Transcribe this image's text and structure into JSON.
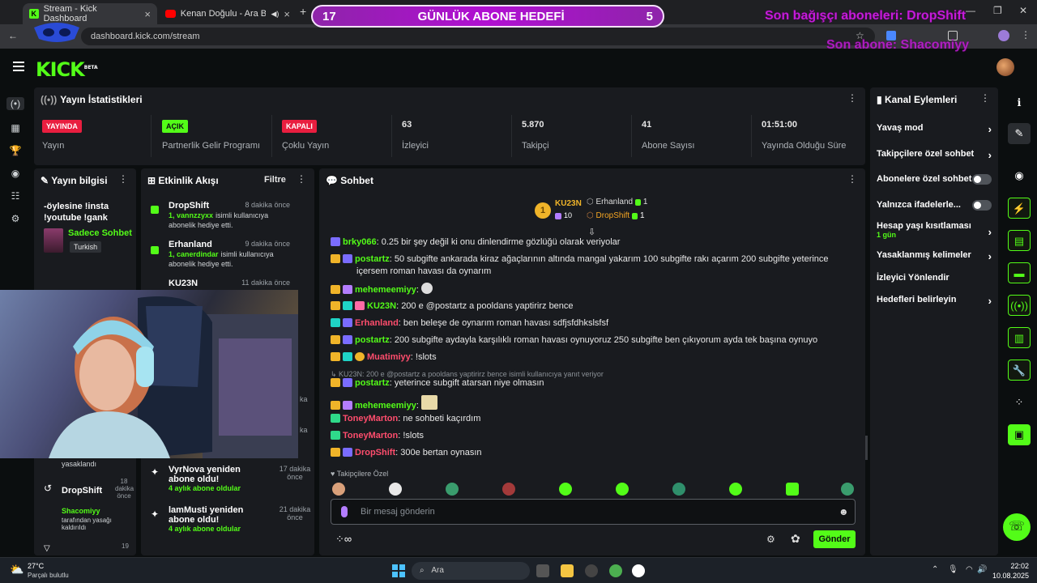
{
  "browser": {
    "tabs": [
      {
        "title": "Stream - Kick Dashboard"
      },
      {
        "title": "Kenan Doğulu - Ara Beni Lütfe"
      }
    ],
    "url": "dashboard.kick.com/stream"
  },
  "overlay": {
    "goal_left": "17",
    "goal_title": "GÜNLÜK ABONE HEDEFİ",
    "goal_right": "5",
    "last_gift": "Son bağışçı aboneleri: DropShift",
    "last_sub": "Son abone: Shacomiyy"
  },
  "stream_stats": {
    "title": "Yayın İstatistikleri",
    "items": [
      {
        "value": "YAYINDA",
        "label": "Yayın"
      },
      {
        "value": "AÇIK",
        "label": "Partnerlik Gelir Programı"
      },
      {
        "value": "KAPALI",
        "label": "Çoklu Yayın"
      },
      {
        "value": "63",
        "label": "İzleyici"
      },
      {
        "value": "5.870",
        "label": "Takipçi"
      },
      {
        "value": "41",
        "label": "Abone Sayısı"
      },
      {
        "value": "01:51:00",
        "label": "Yayında Olduğu Süre"
      }
    ]
  },
  "stream_info": {
    "title": "Yayın bilgisi",
    "stream_title": "-öylesine !insta !youtube !gank",
    "category": "Sadece Sohbet",
    "language": "Turkish",
    "partial_text": "yasaklandı",
    "ban_item": {
      "name": "DropShift",
      "time": "18 dakika önce",
      "detail_user": "Shacomiyy",
      "detail": "tarafından yasağı kaldırıldı"
    },
    "bottom_time": "19"
  },
  "activity": {
    "title": "Etkinlik Akışı",
    "filter": "Filtre",
    "items": [
      {
        "name": "DropShift",
        "time": "8 dakika önce",
        "highlight": "1, vannzzyxx",
        "text": "isimli kullanıcıya abonelik hediye etti."
      },
      {
        "name": "Erhanland",
        "time": "9 dakika önce",
        "highlight": "1, canerdindar",
        "text": "isimli kullanıcıya abonelik hediye etti."
      },
      {
        "name": "KU23N",
        "time": "11 dakika önce"
      }
    ],
    "items2": [
      {
        "name": "VyrNova yeniden abone oldu!",
        "time": "17 dakika önce",
        "highlight": "4 aylık abone oldular"
      },
      {
        "name": "lamMusti yeniden abone oldu!",
        "time": "21 dakika önce",
        "highlight": "4 aylık abone oldular"
      }
    ],
    "partial_time1": "ka",
    "partial_time2": "ka"
  },
  "chat": {
    "title": "Sohbet",
    "top_gifter": {
      "rank": "1",
      "name": "KU23N",
      "count": "10"
    },
    "leaders": [
      {
        "name": "Erhanland",
        "count": "1"
      },
      {
        "name": "DropShift",
        "count": "1"
      }
    ],
    "messages": [
      {
        "user": "brky066",
        "text": ": 0.25 bir şey değil ki onu dinlendirme gözlüğü olarak veriyolar",
        "color": "#53fc18"
      },
      {
        "user": "postartz",
        "text": ": 50 subgifte ankarada kiraz ağaçlarının altında mangal yakarım 100 subgifte rakı açarım 200 subgifte yeterince içersem roman havası da oynarım",
        "color": "#53fc18"
      },
      {
        "user": "mehemeemiyy",
        "text": ":",
        "color": "#53fc18"
      },
      {
        "user": "KU23N",
        "text": ": 200 e @postartz a pooldans yaptirirz bence",
        "color": "#53fc18"
      },
      {
        "user": "Erhanland",
        "text": ": ben beleşe de oynarım roman havası sdfjsfdhkslsfsf",
        "color": "#ff4d6d"
      },
      {
        "user": "postartz",
        "text": ": 200 subgifte aydayla karşılıklı roman havası oynuyoruz 250 subgifte ben çıkıyorum ayda tek başına oynuyo",
        "color": "#53fc18"
      },
      {
        "user": "Muatimiyy",
        "text": ": !slots",
        "color": "#ff4d6d"
      },
      {
        "user": "postartz",
        "text": ": yeterince subgift atarsan niye olmasın",
        "color": "#53fc18",
        "reply": "KU23N: 200 e @postartz a pooldans yaptirirz bence isimli kullanıcıya yanıt veriyor"
      },
      {
        "user": "mehemeemiyy",
        "text": ":",
        "color": "#53fc18"
      },
      {
        "user": "ToneyMarton",
        "text": ": ne sohbeti kaçırdım",
        "color": "#ff4d6d"
      },
      {
        "user": "ToneyMarton",
        "text": ": !slots",
        "color": "#ff4d6d"
      },
      {
        "user": "DropShift",
        "text": ": 300e bertan oynasın",
        "color": "#ff4d6d"
      }
    ],
    "emote_label": "Takipçilere Özel",
    "input_placeholder": "Bir mesaj gönderin",
    "send_button": "Gönder"
  },
  "channel_actions": {
    "title": "Kanal Eylemleri",
    "items": [
      {
        "label": "Yavaş mod",
        "type": "chevron"
      },
      {
        "label": "Takipçilere özel sohbet",
        "type": "chevron"
      },
      {
        "label": "Abonelere özel sohbet",
        "type": "toggle"
      },
      {
        "label": "Yalnızca ifadelerle...",
        "type": "toggle"
      },
      {
        "label": "Hesap yaşı kısıtlaması",
        "type": "chevron",
        "sub": "1 gün"
      },
      {
        "label": "Yasaklanmış kelimeler",
        "type": "chevron"
      },
      {
        "label": "İzleyici Yönlendir",
        "type": "none"
      },
      {
        "label": "Hedefleri belirleyin",
        "type": "chevron"
      }
    ]
  },
  "taskbar": {
    "weather_temp": "27°C",
    "weather_desc": "Parçalı bulutlu",
    "search": "Ara",
    "time": "22:02",
    "date": "10.08.2025"
  },
  "colors": {
    "accent": "#53fc18",
    "panel": "#191b1f",
    "bg": "#0b0e0f",
    "goal": "#b10fd2"
  }
}
